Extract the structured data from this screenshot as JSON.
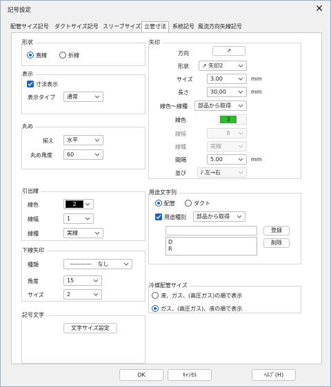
{
  "window": {
    "title": "記号設定",
    "close_glyph": "✕"
  },
  "tabs": [
    "配管サイズ記号",
    "ダクトサイズ記号",
    "スリーブサイズ記号",
    "立管寸法",
    "系統記号",
    "風流方向矢線記号"
  ],
  "selected_tab_index": 3,
  "shape": {
    "title": "形状",
    "options": [
      "直線",
      "折線"
    ],
    "selected": "直線"
  },
  "display": {
    "title": "表示",
    "dimension_display_label": "寸法表示",
    "dimension_display_checked": true,
    "display_type_label": "表示タイプ",
    "display_type_value": "通常"
  },
  "rounding": {
    "title": "丸め",
    "align_label": "揃え",
    "align_value": "水平",
    "angle_label": "丸め角度",
    "angle_value": "60"
  },
  "leader": {
    "title": "引出線",
    "color_label": "線色",
    "color_value": "2",
    "color_swatch": "#000000",
    "width_label": "線幅",
    "width_value": "1",
    "type_label": "線種",
    "type_value": "実線"
  },
  "lower_arrow": {
    "title": "下線矢印",
    "kind_label": "種類",
    "kind_line": "————",
    "kind_value": "なし",
    "angle_label": "角度",
    "angle_value": "15",
    "size_label": "サイズ",
    "size_value": "2"
  },
  "symbol_text": {
    "title": "記号文字",
    "button_label": "文字サイズ設定"
  },
  "arrow": {
    "title": "矢印",
    "direction_label": "方向",
    "direction_glyph": "↗",
    "shape_label": "形状",
    "shape_value": "矢印2",
    "size_label": "サイズ",
    "size_value": "3.00",
    "size_unit": "mm",
    "length_label": "長さ",
    "length_value": "30.00",
    "length_unit": "mm",
    "color_type_label": "線色～線種",
    "color_type_value": "部品から取得",
    "color_label": "線色",
    "color_value": "3",
    "color_swatch": "#22c322",
    "width_label": "線幅",
    "width_value": "8",
    "type_label": "線種",
    "type_value": "実線",
    "spacing_label": "間隔",
    "spacing_value": "5.00",
    "spacing_unit": "mm",
    "order_label": "並び",
    "order_value": "左→右"
  },
  "usage": {
    "title": "用途文字列",
    "options": [
      "配管",
      "ダクト"
    ],
    "selected": "配管",
    "usage_type_label": "用途種別",
    "usage_type_checked": true,
    "usage_type_value": "部品から取得",
    "input_value": "",
    "register_label": "登録",
    "delete_label": "削除",
    "list_items": [
      "D",
      "R"
    ]
  },
  "refrigerant": {
    "title": "冷媒配管サイズ",
    "options": [
      "液、ガス、(高圧ガス)の順で表示",
      "ガス、(高圧ガス)、液の順で表示"
    ],
    "selected_index": 1
  },
  "footer": {
    "ok": "OK",
    "cancel": "ｷｬﾝｾﾙ",
    "help": "ﾍﾙﾌﾟ(H)"
  }
}
